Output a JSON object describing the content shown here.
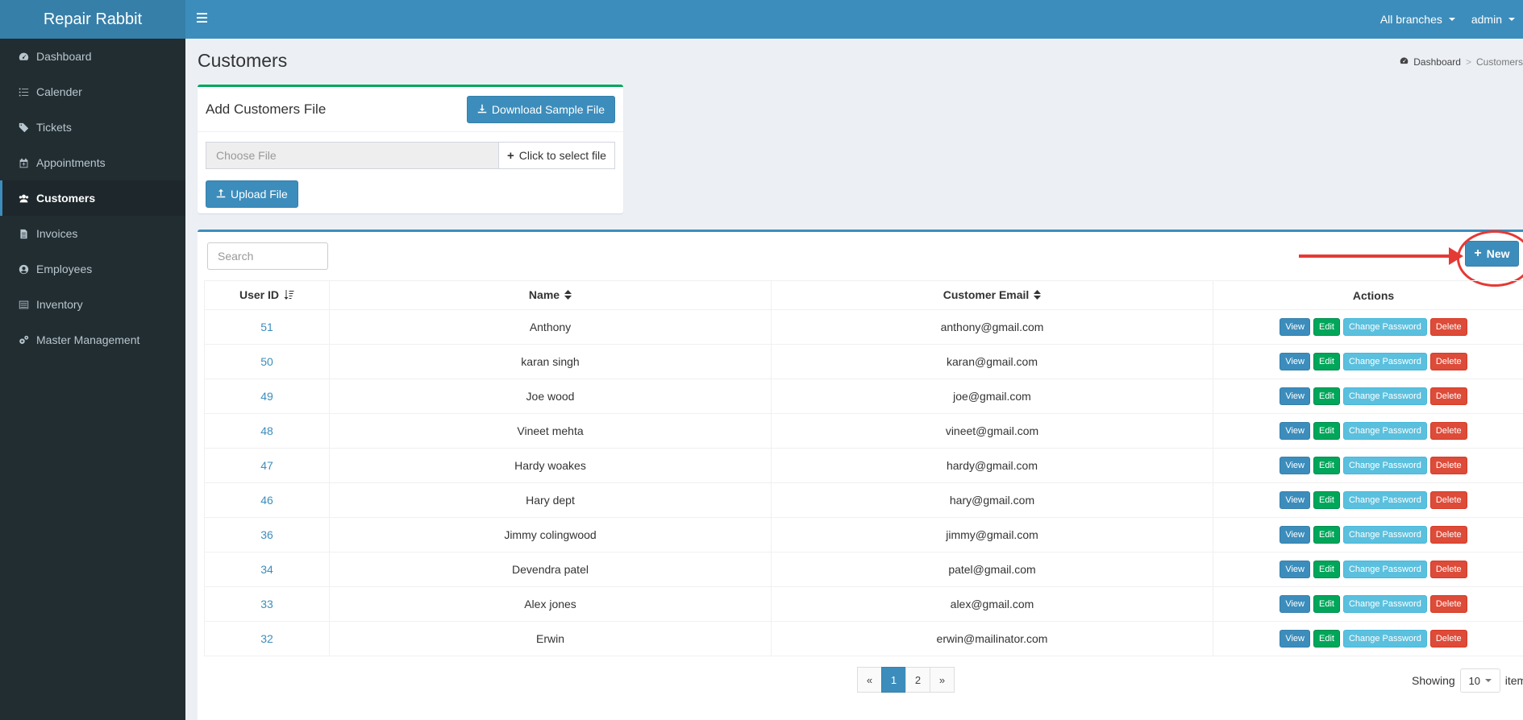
{
  "app": {
    "title": "Repair Rabbit"
  },
  "topbar": {
    "branches": "All branches",
    "user": "admin"
  },
  "sidebar": {
    "items": [
      {
        "label": "Dashboard",
        "icon": "dashboard-icon"
      },
      {
        "label": "Calender",
        "icon": "list-icon"
      },
      {
        "label": "Tickets",
        "icon": "tag-icon"
      },
      {
        "label": "Appointments",
        "icon": "calendar-plus-icon"
      },
      {
        "label": "Customers",
        "icon": "users-icon",
        "active": true
      },
      {
        "label": "Invoices",
        "icon": "file-text-icon"
      },
      {
        "label": "Employees",
        "icon": "user-circle-icon"
      },
      {
        "label": "Inventory",
        "icon": "list-alt-icon"
      },
      {
        "label": "Master Management",
        "icon": "cogs-icon"
      }
    ]
  },
  "page": {
    "title": "Customers"
  },
  "breadcrumb": {
    "home": "Dashboard",
    "current": "Customers"
  },
  "upload": {
    "title": "Add Customers File",
    "download_label": "Download Sample File",
    "file_placeholder": "Choose File",
    "select_label": "Click to select file",
    "upload_label": "Upload File"
  },
  "list": {
    "search_placeholder": "Search",
    "new_label": "New",
    "columns": {
      "user_id": "User ID",
      "name": "Name",
      "email": "Customer Email",
      "actions": "Actions"
    },
    "action_labels": {
      "view": "View",
      "edit": "Edit",
      "change_password": "Change Password",
      "delete": "Delete"
    },
    "rows": [
      {
        "id": "51",
        "name": "Anthony",
        "email": "anthony@gmail.com"
      },
      {
        "id": "50",
        "name": "karan singh",
        "email": "karan@gmail.com"
      },
      {
        "id": "49",
        "name": "Joe wood",
        "email": "joe@gmail.com"
      },
      {
        "id": "48",
        "name": "Vineet mehta",
        "email": "vineet@gmail.com"
      },
      {
        "id": "47",
        "name": "Hardy woakes",
        "email": "hardy@gmail.com"
      },
      {
        "id": "46",
        "name": "Hary dept",
        "email": "hary@gmail.com"
      },
      {
        "id": "36",
        "name": "Jimmy colingwood",
        "email": "jimmy@gmail.com"
      },
      {
        "id": "34",
        "name": "Devendra patel",
        "email": "patel@gmail.com"
      },
      {
        "id": "33",
        "name": "Alex jones",
        "email": "alex@gmail.com"
      },
      {
        "id": "32",
        "name": "Erwin",
        "email": "erwin@mailinator.com"
      }
    ]
  },
  "pagination": {
    "prev": "«",
    "pages": [
      "1",
      "2"
    ],
    "current": "1",
    "next": "»"
  },
  "page_size": {
    "showing": "Showing",
    "value": "10",
    "items": "items"
  },
  "colors": {
    "brand": "#3c8dbc",
    "sidebar": "#222d32",
    "success": "#00a65a",
    "info": "#5bc0de",
    "danger": "#dd4b39",
    "annotation": "#e53935"
  }
}
